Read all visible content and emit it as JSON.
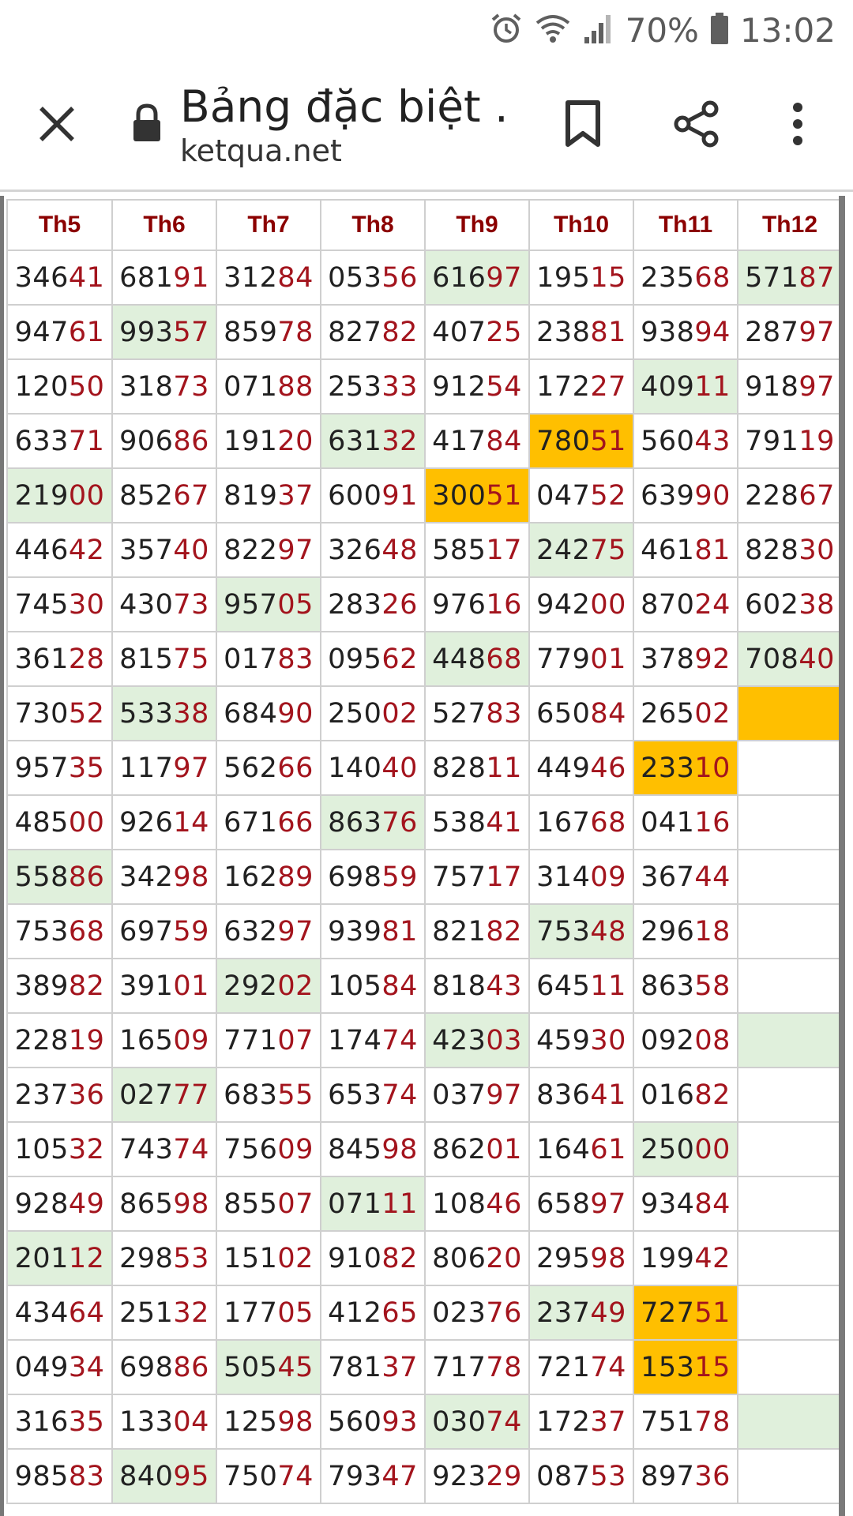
{
  "status_bar": {
    "battery_percent": "70%",
    "time": "13:02",
    "icons": [
      "alarm-icon",
      "wifi-icon",
      "signal-icon",
      "battery-icon"
    ]
  },
  "browser": {
    "page_title": "Bảng đặc biệt ...",
    "domain": "ketqua.net",
    "icons": [
      "close-icon",
      "lock-icon",
      "bookmark-icon",
      "share-icon",
      "more-vert-icon"
    ]
  },
  "colors": {
    "header_text": "#8b0000",
    "digit_tail": "#a3141d",
    "highlight_green": "#e0f0dc",
    "highlight_orange": "#ffbf00"
  },
  "table": {
    "columns": [
      "Th5",
      "Th6",
      "Th7",
      "Th8",
      "Th9",
      "Th10",
      "Th11",
      "Th12"
    ],
    "rows": [
      [
        {
          "v": "34641"
        },
        {
          "v": "68191"
        },
        {
          "v": "31284"
        },
        {
          "v": "05356"
        },
        {
          "v": "61697",
          "h": "g"
        },
        {
          "v": "19515"
        },
        {
          "v": "23568"
        },
        {
          "v": "57187",
          "h": "g"
        }
      ],
      [
        {
          "v": "94761"
        },
        {
          "v": "99357",
          "h": "g"
        },
        {
          "v": "85978"
        },
        {
          "v": "82782"
        },
        {
          "v": "40725"
        },
        {
          "v": "23881"
        },
        {
          "v": "93894"
        },
        {
          "v": "28797"
        }
      ],
      [
        {
          "v": "12050"
        },
        {
          "v": "31873"
        },
        {
          "v": "07188"
        },
        {
          "v": "25333"
        },
        {
          "v": "91254"
        },
        {
          "v": "17227"
        },
        {
          "v": "40911",
          "h": "g"
        },
        {
          "v": "91897"
        }
      ],
      [
        {
          "v": "63371"
        },
        {
          "v": "90686"
        },
        {
          "v": "19120"
        },
        {
          "v": "63132",
          "h": "g"
        },
        {
          "v": "41784"
        },
        {
          "v": "78051",
          "h": "o"
        },
        {
          "v": "56043"
        },
        {
          "v": "79119"
        }
      ],
      [
        {
          "v": "21900",
          "h": "g"
        },
        {
          "v": "85267"
        },
        {
          "v": "81937"
        },
        {
          "v": "60091"
        },
        {
          "v": "30051",
          "h": "o"
        },
        {
          "v": "04752"
        },
        {
          "v": "63990"
        },
        {
          "v": "22867"
        }
      ],
      [
        {
          "v": "44642"
        },
        {
          "v": "35740"
        },
        {
          "v": "82297"
        },
        {
          "v": "32648"
        },
        {
          "v": "58517"
        },
        {
          "v": "24275",
          "h": "g"
        },
        {
          "v": "46181"
        },
        {
          "v": "82830"
        }
      ],
      [
        {
          "v": "74530"
        },
        {
          "v": "43073"
        },
        {
          "v": "95705",
          "h": "g"
        },
        {
          "v": "28326"
        },
        {
          "v": "97616"
        },
        {
          "v": "94200"
        },
        {
          "v": "87024"
        },
        {
          "v": "60238"
        }
      ],
      [
        {
          "v": "36128"
        },
        {
          "v": "81575"
        },
        {
          "v": "01783"
        },
        {
          "v": "09562"
        },
        {
          "v": "44868",
          "h": "g"
        },
        {
          "v": "77901"
        },
        {
          "v": "37892"
        },
        {
          "v": "70840",
          "h": "g"
        }
      ],
      [
        {
          "v": "73052"
        },
        {
          "v": "53338",
          "h": "g"
        },
        {
          "v": "68490"
        },
        {
          "v": "25002"
        },
        {
          "v": "52783"
        },
        {
          "v": "65084"
        },
        {
          "v": "26502"
        },
        {
          "v": "",
          "h": "o"
        }
      ],
      [
        {
          "v": "95735"
        },
        {
          "v": "11797"
        },
        {
          "v": "56266"
        },
        {
          "v": "14040"
        },
        {
          "v": "82811"
        },
        {
          "v": "44946"
        },
        {
          "v": "23310",
          "h": "o"
        },
        {
          "v": ""
        }
      ],
      [
        {
          "v": "48500"
        },
        {
          "v": "92614"
        },
        {
          "v": "67166"
        },
        {
          "v": "86376",
          "h": "g"
        },
        {
          "v": "53841"
        },
        {
          "v": "16768"
        },
        {
          "v": "04116"
        },
        {
          "v": ""
        }
      ],
      [
        {
          "v": "55886",
          "h": "g"
        },
        {
          "v": "34298"
        },
        {
          "v": "16289"
        },
        {
          "v": "69859"
        },
        {
          "v": "75717"
        },
        {
          "v": "31409"
        },
        {
          "v": "36744"
        },
        {
          "v": ""
        }
      ],
      [
        {
          "v": "75368"
        },
        {
          "v": "69759"
        },
        {
          "v": "63297"
        },
        {
          "v": "93981"
        },
        {
          "v": "82182"
        },
        {
          "v": "75348",
          "h": "g"
        },
        {
          "v": "29618"
        },
        {
          "v": ""
        }
      ],
      [
        {
          "v": "38982"
        },
        {
          "v": "39101"
        },
        {
          "v": "29202",
          "h": "g"
        },
        {
          "v": "10584"
        },
        {
          "v": "81843"
        },
        {
          "v": "64511"
        },
        {
          "v": "86358"
        },
        {
          "v": ""
        }
      ],
      [
        {
          "v": "22819"
        },
        {
          "v": "16509"
        },
        {
          "v": "77107"
        },
        {
          "v": "17474"
        },
        {
          "v": "42303",
          "h": "g"
        },
        {
          "v": "45930"
        },
        {
          "v": "09208"
        },
        {
          "v": "",
          "h": "g"
        }
      ],
      [
        {
          "v": "23736"
        },
        {
          "v": "02777",
          "h": "g"
        },
        {
          "v": "68355"
        },
        {
          "v": "65374"
        },
        {
          "v": "03797"
        },
        {
          "v": "83641"
        },
        {
          "v": "01682"
        },
        {
          "v": ""
        }
      ],
      [
        {
          "v": "10532"
        },
        {
          "v": "74374"
        },
        {
          "v": "75609"
        },
        {
          "v": "84598"
        },
        {
          "v": "86201"
        },
        {
          "v": "16461"
        },
        {
          "v": "25000",
          "h": "g"
        },
        {
          "v": ""
        }
      ],
      [
        {
          "v": "92849"
        },
        {
          "v": "86598"
        },
        {
          "v": "85507"
        },
        {
          "v": "07111",
          "h": "g"
        },
        {
          "v": "10846"
        },
        {
          "v": "65897"
        },
        {
          "v": "93484"
        },
        {
          "v": ""
        }
      ],
      [
        {
          "v": "20112",
          "h": "g"
        },
        {
          "v": "29853"
        },
        {
          "v": "15102"
        },
        {
          "v": "91082"
        },
        {
          "v": "80620"
        },
        {
          "v": "29598"
        },
        {
          "v": "19942"
        },
        {
          "v": ""
        }
      ],
      [
        {
          "v": "43464"
        },
        {
          "v": "25132"
        },
        {
          "v": "17705"
        },
        {
          "v": "41265"
        },
        {
          "v": "02376"
        },
        {
          "v": "23749",
          "h": "g"
        },
        {
          "v": "72751",
          "h": "o"
        },
        {
          "v": ""
        }
      ],
      [
        {
          "v": "04934"
        },
        {
          "v": "69886"
        },
        {
          "v": "50545",
          "h": "g"
        },
        {
          "v": "78137"
        },
        {
          "v": "71778"
        },
        {
          "v": "72174"
        },
        {
          "v": "15315",
          "h": "o"
        },
        {
          "v": ""
        }
      ],
      [
        {
          "v": "31635"
        },
        {
          "v": "13304"
        },
        {
          "v": "12598"
        },
        {
          "v": "56093"
        },
        {
          "v": "03074",
          "h": "g"
        },
        {
          "v": "17237"
        },
        {
          "v": "75178"
        },
        {
          "v": "",
          "h": "g"
        }
      ],
      [
        {
          "v": "98583"
        },
        {
          "v": "84095",
          "h": "g"
        },
        {
          "v": "75074"
        },
        {
          "v": "79347"
        },
        {
          "v": "92329"
        },
        {
          "v": "08753"
        },
        {
          "v": "89736"
        },
        {
          "v": ""
        }
      ]
    ]
  }
}
